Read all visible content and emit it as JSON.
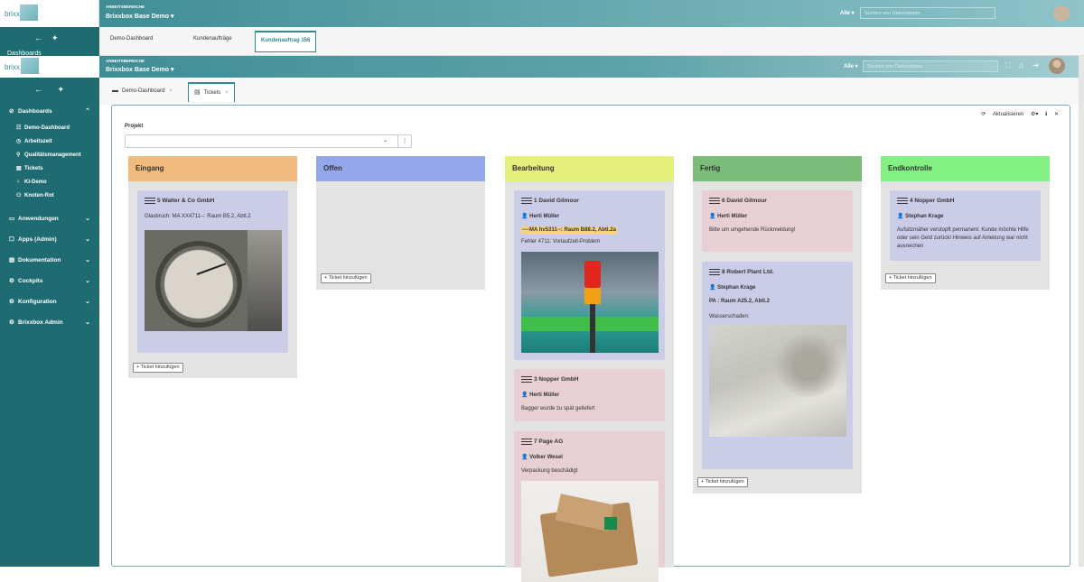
{
  "app": {
    "logo_text": "brixx",
    "logo_box_text": "box"
  },
  "ghost": {
    "workspace_label": "ARBEITSBEREICHE",
    "workspace_name": "Brixxbox Base Demo ▾",
    "alle": "Alle ▾",
    "search_placeholder": "Suchen von Datensätzen",
    "tabs": [
      "Demo-Dashboard",
      "Kundenaufträge",
      "Kundenauftrag 156"
    ],
    "sidebar_dashboards": "Dashboards"
  },
  "topbar": {
    "workspace_label": "ARBEITSBEREICHE",
    "workspace_name": "Brixxbox Base Demo ▾",
    "alle": "Alle ▾",
    "search_placeholder": "Suchen von Datensätzen"
  },
  "sidebar": {
    "items": [
      {
        "label": "Dashboards",
        "icon": "⊘",
        "chevron": "⌃"
      },
      {
        "label": "Anwendungen",
        "icon": "▭",
        "chevron": "⌄"
      },
      {
        "label": "Apps (Admin)",
        "icon": "☐",
        "chevron": "⌄"
      },
      {
        "label": "Dokumentation",
        "icon": "▤",
        "chevron": "⌄"
      },
      {
        "label": "Cockpits",
        "icon": "⚙",
        "chevron": "⌄"
      },
      {
        "label": "Konfiguration",
        "icon": "⚙",
        "chevron": "⌄"
      },
      {
        "label": "Brixxbox Admin",
        "icon": "⚙",
        "chevron": "⌄"
      }
    ],
    "sub_items": [
      {
        "label": "Demo-Dashboard",
        "icon": "☷"
      },
      {
        "label": "Arbeitszeit",
        "icon": "◷"
      },
      {
        "label": "Qualitätsmanagement",
        "icon": "⚲"
      },
      {
        "label": "Tickets",
        "icon": "▤"
      },
      {
        "label": "KI-Demo",
        "icon": "♀"
      },
      {
        "label": "Knoten-Rot",
        "icon": "⚇"
      }
    ]
  },
  "tabs": [
    {
      "label": "Demo-Dashboard",
      "icon": "▬"
    },
    {
      "label": "Tickets",
      "icon": "▤"
    }
  ],
  "panel": {
    "refresh_label": "Aktualisieren",
    "project_label": "Projekt",
    "project_value": ""
  },
  "columns": [
    {
      "title": "Eingang",
      "color": "#f0bb7c"
    },
    {
      "title": "Offen",
      "color": "#94a7ea"
    },
    {
      "title": "Bearbeitung",
      "color": "#e5ef7c"
    },
    {
      "title": "Fertig",
      "color": "#79bd78"
    },
    {
      "title": "Endkontrolle",
      "color": "#82f182"
    }
  ],
  "add_ticket_label": "+ Ticket hinzufügen",
  "cards": {
    "c1": {
      "title": "5 Walter & Co GmbH",
      "text": "Glasbruch: MA XX4711--: Raum B5.2, Abtl.2"
    },
    "c2": {
      "title": "1 David Gilmour",
      "person": "Herti Müller",
      "highlight": "----MA hv5311--: Raum B88.2, Abtl.2a",
      "text": "Fehler 4711: Vorlaufzeit-Problem"
    },
    "c3": {
      "title": "3 Nopper GmbH",
      "person": "Herti Müller",
      "text": "Bagger wurde zu spät geliefert"
    },
    "c4": {
      "title": "7 Page AG",
      "person": "Volker Wesel",
      "text": "Verpackung beschädigt"
    },
    "c5": {
      "title": "6 David Gilmour",
      "person": "Herti Müller",
      "text": "Bitte um umgehende Rückmeldung!"
    },
    "c6": {
      "title": "8 Robert Plant Ltd.",
      "person": "Stephan Krage",
      "bold_line": "PA : Raum A25.2, Abtl.2",
      "text": "Wasserschaden:"
    },
    "c7": {
      "title": "4 Nopper GmbH",
      "person": "Stephan Krage",
      "text": "Aufsitzmäher verstopft permanent. Kunde möchte Hilfe oder sein Geld zurück! Hinweis auf Anleitung war nicht ausreichen"
    }
  }
}
